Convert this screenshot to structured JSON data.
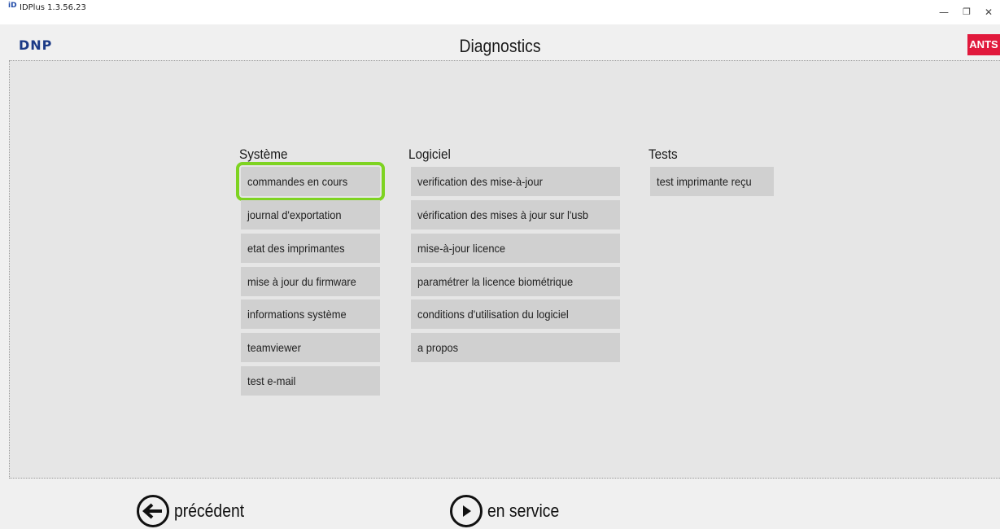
{
  "window": {
    "title": "IDPlus 1.3.56.23",
    "icon_text": "iD",
    "minimize": "—",
    "maximize": "❐",
    "close": "✕"
  },
  "header": {
    "brand": "DNP",
    "title": "Diagnostics",
    "badge": "ANTS",
    "badge_color": "#e1193c"
  },
  "groups": {
    "systeme": {
      "title": "Système",
      "items": [
        "commandes en cours",
        "journal d'exportation",
        "etat des imprimantes",
        "mise à jour du firmware",
        "informations système",
        "teamviewer",
        "test e-mail"
      ]
    },
    "logiciel": {
      "title": "Logiciel",
      "items": [
        "verification des mise-à-jour",
        "vérification des mises à jour sur l'usb",
        "mise-à-jour licence",
        "paramétrer la licence biométrique",
        "conditions d'utilisation du logiciel",
        "a propos"
      ]
    },
    "tests": {
      "title": "Tests",
      "items": [
        "test imprimante reçu"
      ]
    }
  },
  "selected_item": "commandes en cours",
  "selection_color": "#7ed321",
  "footer": {
    "back_label": "précédent",
    "back_icon": "arrow-left-circle-icon",
    "service_label": "en service",
    "service_icon": "play-circle-icon"
  }
}
